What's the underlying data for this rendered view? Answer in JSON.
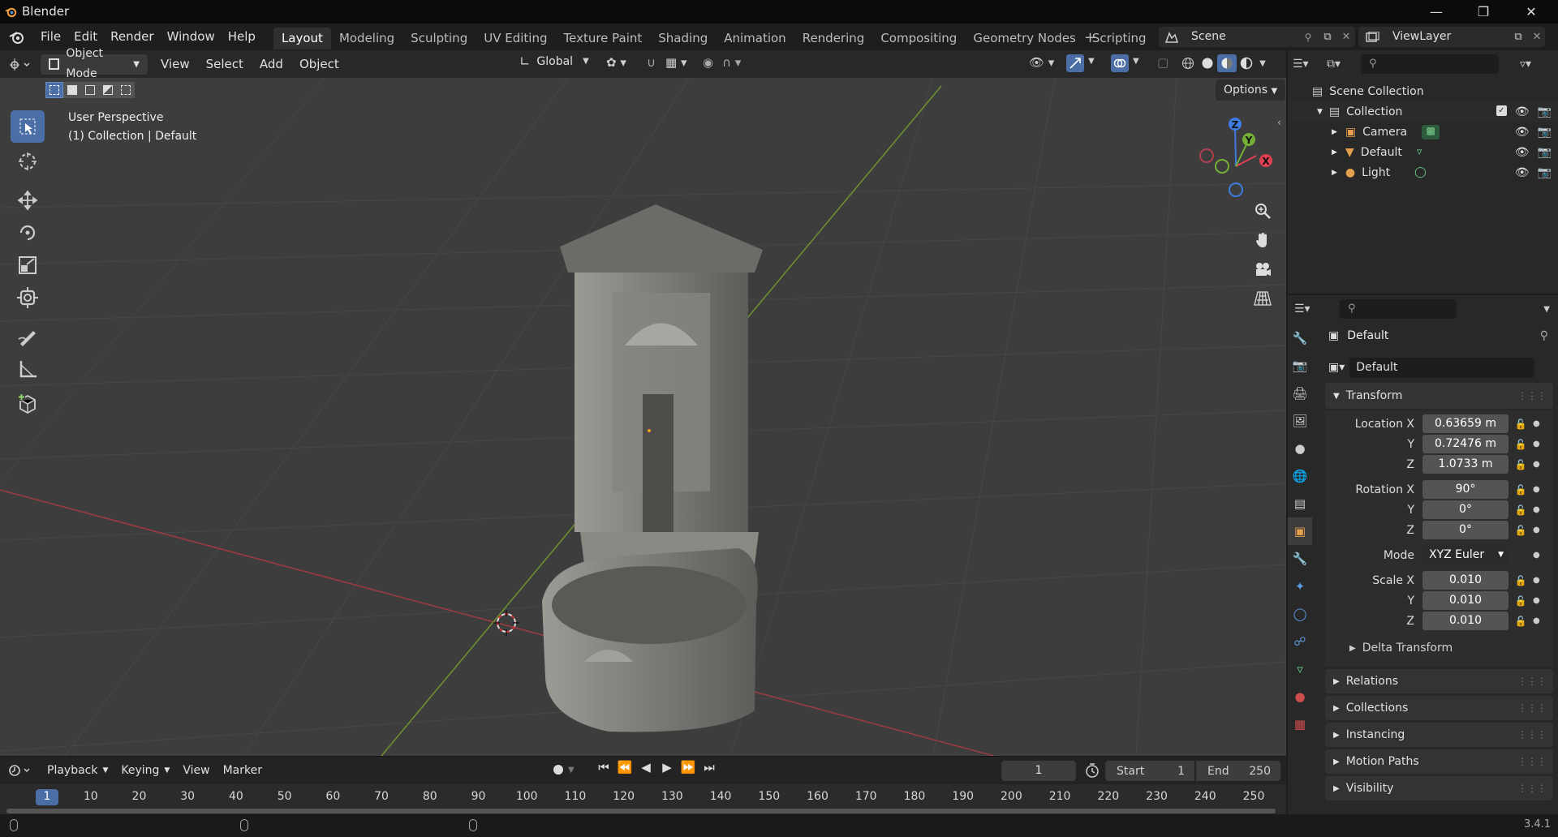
{
  "app": {
    "title": "Blender",
    "version": "3.4.1"
  },
  "menu": [
    "File",
    "Edit",
    "Render",
    "Window",
    "Help"
  ],
  "workspaces": [
    "Layout",
    "Modeling",
    "Sculpting",
    "UV Editing",
    "Texture Paint",
    "Shading",
    "Animation",
    "Rendering",
    "Compositing",
    "Geometry Nodes",
    "Scripting"
  ],
  "active_workspace": "Layout",
  "scene": {
    "name": "Scene",
    "view_layer": "ViewLayer"
  },
  "viewport_header": {
    "mode": "Object Mode",
    "items": [
      "View",
      "Select",
      "Add",
      "Object"
    ],
    "transform_orientation": "Global",
    "options": "Options"
  },
  "viewport": {
    "overlay_line1": "User Perspective",
    "overlay_line2": "(1) Collection | Default",
    "gizmo": {
      "x": "X",
      "y": "Y",
      "z": "Z"
    }
  },
  "outliner": {
    "root": "Scene Collection",
    "collection": "Collection",
    "items": [
      "Camera",
      "Default",
      "Light"
    ]
  },
  "properties": {
    "object_name": "Default",
    "data_name": "Default",
    "transform_label": "Transform",
    "location": {
      "label": "Location X",
      "x": "0.63659 m",
      "y": "0.72476 m",
      "z": "1.0733 m"
    },
    "rotation": {
      "label": "Rotation X",
      "x": "90°",
      "y": "0°",
      "z": "0°"
    },
    "mode": {
      "label": "Mode",
      "value": "XYZ Euler"
    },
    "scale": {
      "label": "Scale X",
      "x": "0.010",
      "y": "0.010",
      "z": "0.010"
    },
    "axis_y": "Y",
    "axis_z": "Z",
    "subpanels": [
      "Delta Transform"
    ],
    "panels": [
      "Relations",
      "Collections",
      "Instancing",
      "Motion Paths",
      "Visibility"
    ]
  },
  "timeline": {
    "menus": [
      "Playback",
      "Keying",
      "View",
      "Marker"
    ],
    "current_frame": "1",
    "start_label": "Start",
    "start": "1",
    "end_label": "End",
    "end": "250",
    "ticks": [
      "1",
      "10",
      "20",
      "30",
      "40",
      "50",
      "60",
      "70",
      "80",
      "90",
      "100",
      "110",
      "120",
      "130",
      "140",
      "150",
      "160",
      "170",
      "180",
      "190",
      "200",
      "210",
      "220",
      "230",
      "240",
      "250"
    ]
  }
}
